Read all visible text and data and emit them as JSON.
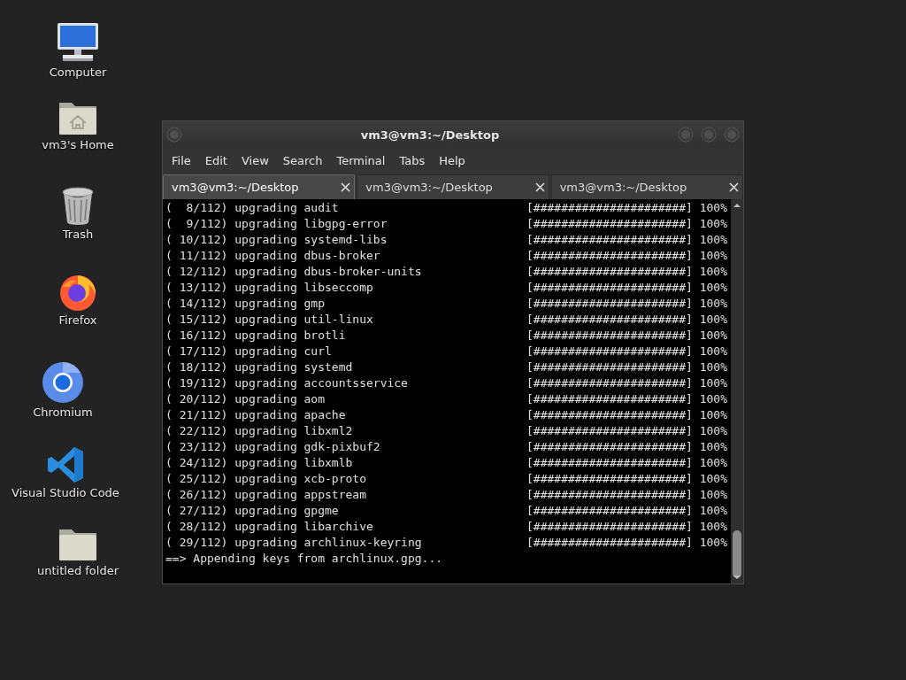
{
  "desktop_icons": [
    {
      "label": "Computer",
      "kind": "computer"
    },
    {
      "label": "vm3's Home",
      "kind": "home"
    },
    {
      "label": "Trash",
      "kind": "trash"
    },
    {
      "label": "Firefox",
      "kind": "firefox"
    },
    {
      "label": "Chromium",
      "kind": "chromium"
    },
    {
      "label": "Visual Studio Code",
      "kind": "vscode"
    },
    {
      "label": "untitled folder",
      "kind": "folder"
    }
  ],
  "window": {
    "title": "vm3@vm3:~/Desktop",
    "menu": [
      "File",
      "Edit",
      "View",
      "Search",
      "Terminal",
      "Tabs",
      "Help"
    ],
    "tabs": [
      {
        "label": "vm3@vm3:~/Desktop",
        "selected": true
      },
      {
        "label": "vm3@vm3:~/Desktop",
        "selected": false
      },
      {
        "label": "vm3@vm3:~/Desktop",
        "selected": false
      }
    ],
    "terminal_lines": [
      {
        "text": "(  8/112) upgrading audit",
        "progress": "[######################] 100%"
      },
      {
        "text": "(  9/112) upgrading libgpg-error",
        "progress": "[######################] 100%"
      },
      {
        "text": "( 10/112) upgrading systemd-libs",
        "progress": "[######################] 100%"
      },
      {
        "text": "( 11/112) upgrading dbus-broker",
        "progress": "[######################] 100%"
      },
      {
        "text": "( 12/112) upgrading dbus-broker-units",
        "progress": "[######################] 100%"
      },
      {
        "text": "( 13/112) upgrading libseccomp",
        "progress": "[######################] 100%"
      },
      {
        "text": "( 14/112) upgrading gmp",
        "progress": "[######################] 100%"
      },
      {
        "text": "( 15/112) upgrading util-linux",
        "progress": "[######################] 100%"
      },
      {
        "text": "( 16/112) upgrading brotli",
        "progress": "[######################] 100%"
      },
      {
        "text": "( 17/112) upgrading curl",
        "progress": "[######################] 100%"
      },
      {
        "text": "( 18/112) upgrading systemd",
        "progress": "[######################] 100%"
      },
      {
        "text": "( 19/112) upgrading accountsservice",
        "progress": "[######################] 100%"
      },
      {
        "text": "( 20/112) upgrading aom",
        "progress": "[######################] 100%"
      },
      {
        "text": "( 21/112) upgrading apache",
        "progress": "[######################] 100%"
      },
      {
        "text": "( 22/112) upgrading libxml2",
        "progress": "[######################] 100%"
      },
      {
        "text": "( 23/112) upgrading gdk-pixbuf2",
        "progress": "[######################] 100%"
      },
      {
        "text": "( 24/112) upgrading libxmlb",
        "progress": "[######################] 100%"
      },
      {
        "text": "( 25/112) upgrading xcb-proto",
        "progress": "[######################] 100%"
      },
      {
        "text": "( 26/112) upgrading appstream",
        "progress": "[######################] 100%"
      },
      {
        "text": "( 27/112) upgrading gpgme",
        "progress": "[######################] 100%"
      },
      {
        "text": "( 28/112) upgrading libarchive",
        "progress": "[######################] 100%"
      },
      {
        "text": "( 29/112) upgrading archlinux-keyring",
        "progress": "[######################] 100%"
      },
      {
        "text": "==> Appending keys from archlinux.gpg..."
      }
    ]
  }
}
